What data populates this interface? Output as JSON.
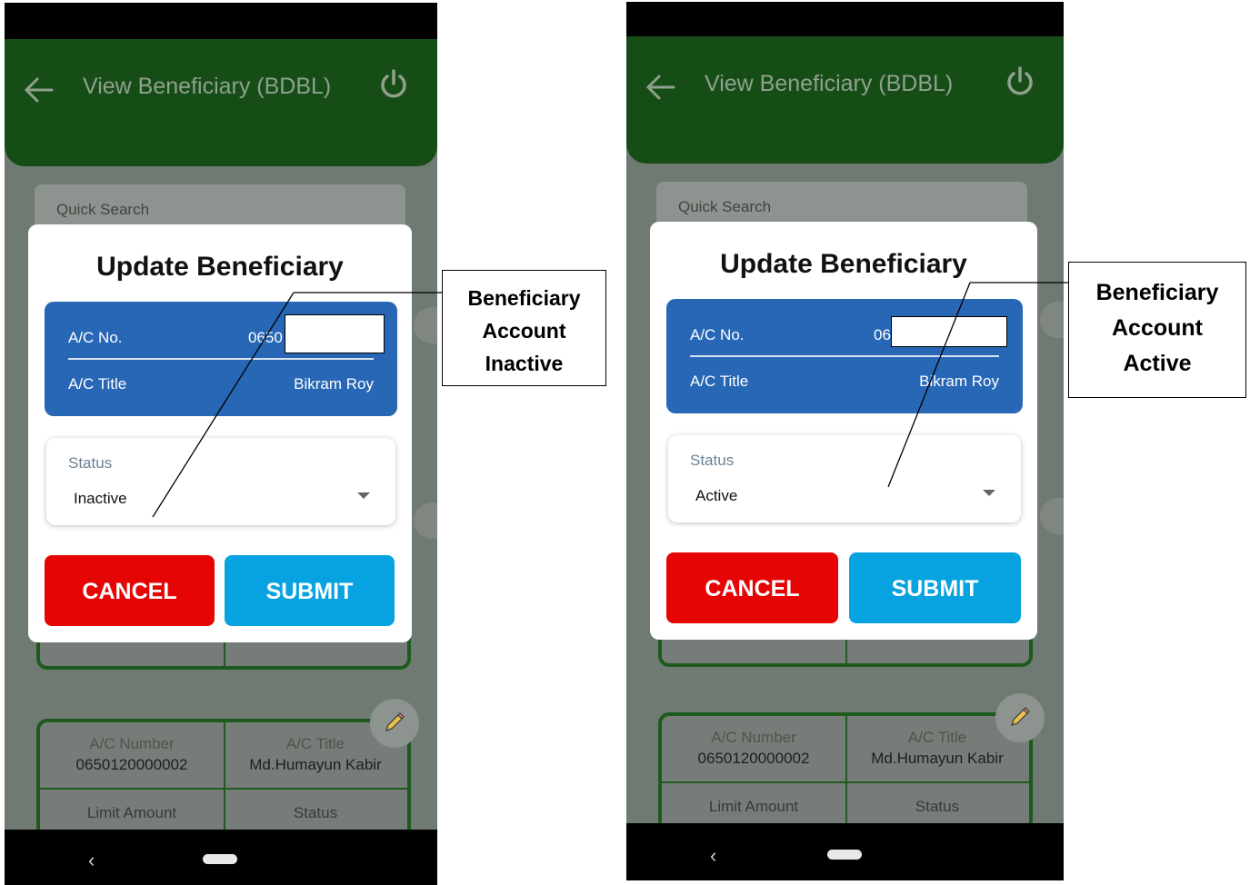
{
  "screens": [
    {
      "header_title": "View Beneficiary (BDBL)",
      "search_placeholder": "Quick Search",
      "modal": {
        "title": "Update Beneficiary",
        "ac_no_label": "A/C No.",
        "ac_no_value": "0650",
        "ac_title_label": "A/C Title",
        "ac_title_value": "Bikram Roy",
        "status_label": "Status",
        "status_value": "Inactive",
        "cancel_label": "CANCEL",
        "submit_label": "SUBMIT"
      },
      "card": {
        "ac_number_label": "A/C Number",
        "ac_number_value": "0650120000002",
        "ac_title_label": "A/C Title",
        "ac_title_value": "Md.Humayun Kabir",
        "limit_label": "Limit Amount",
        "status_label": "Status"
      }
    },
    {
      "header_title": "View Beneficiary (BDBL)",
      "search_placeholder": "Quick Search",
      "modal": {
        "title": "Update Beneficiary",
        "ac_no_label": "A/C No.",
        "ac_no_value": "06",
        "ac_title_label": "A/C Title",
        "ac_title_value": "Bikram Roy",
        "status_label": "Status",
        "status_value": "Active",
        "cancel_label": "CANCEL",
        "submit_label": "SUBMIT"
      },
      "card": {
        "ac_number_label": "A/C Number",
        "ac_number_value": "0650120000002",
        "ac_title_label": "A/C Title",
        "ac_title_value": "Md.Humayun Kabir",
        "limit_label": "Limit Amount",
        "status_label": "Status"
      }
    }
  ],
  "annotations": {
    "left": [
      "Beneficiary",
      "Account",
      "Inactive"
    ],
    "right": [
      "Beneficiary",
      "Account",
      "Active"
    ]
  },
  "colors": {
    "header_green": "#164d16",
    "card_blue": "#2767b5",
    "cancel_red": "#e50505",
    "submit_blue": "#07a3e0"
  }
}
